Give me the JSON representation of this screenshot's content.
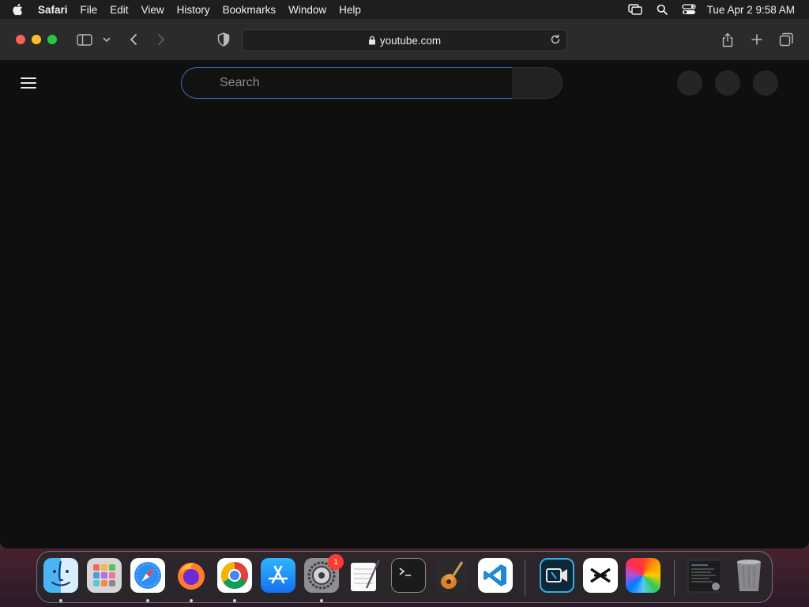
{
  "menubar": {
    "app_name": "Safari",
    "items": [
      "File",
      "Edit",
      "View",
      "History",
      "Bookmarks",
      "Window",
      "Help"
    ],
    "clock": "Tue Apr 2  9:58 AM"
  },
  "browser": {
    "address": "youtube.com"
  },
  "page": {
    "search_placeholder": "Search"
  },
  "dock": {
    "apps": [
      "Finder",
      "Launchpad",
      "Safari",
      "Firefox",
      "Chrome",
      "App Store",
      "System Settings",
      "TextEdit",
      "Terminal",
      "GarageBand",
      "Visual Studio Code",
      "Video Editor",
      "CapCut",
      "Photos",
      "Downloads",
      "Trash"
    ],
    "settings_badge": "1"
  }
}
